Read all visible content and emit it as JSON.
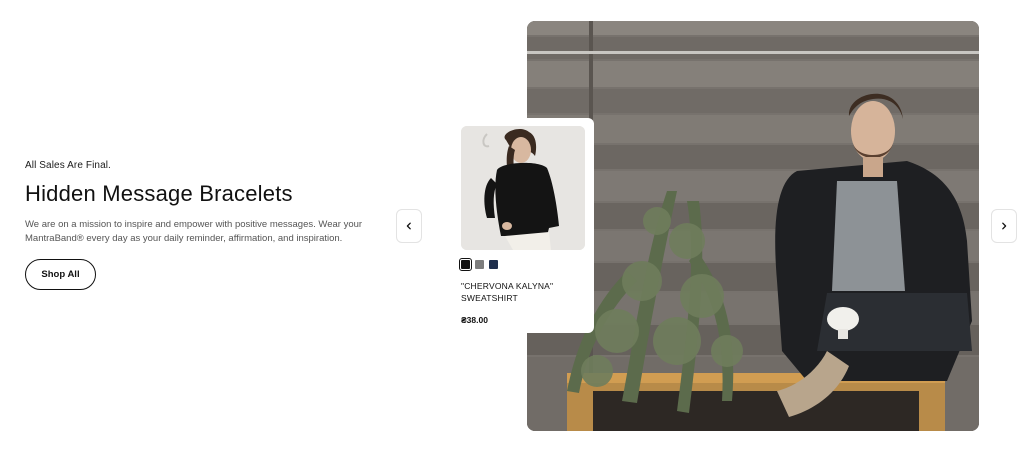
{
  "hero": {
    "eyebrow": "All Sales Are Final.",
    "title": "Hidden Message Bracelets",
    "description": "We are on a mission to inspire and empower with positive messages. Wear your MantraBand® every day as your daily reminder, affirmation, and inspiration.",
    "cta_label": "Shop All"
  },
  "carousel": {
    "prev_icon": "chevron-left-icon",
    "next_icon": "chevron-right-icon"
  },
  "product": {
    "name": "\"CHERVONA KALYNA\" SWEATSHIRT",
    "price": "₴38.00",
    "swatches": [
      {
        "name": "black",
        "color": "#111111",
        "selected": true
      },
      {
        "name": "gray",
        "color": "#7d7d7d",
        "selected": false
      },
      {
        "name": "navy",
        "color": "#1f2f4d",
        "selected": false
      }
    ]
  },
  "colors": {
    "accent": "#111111",
    "text_muted": "#555555",
    "card_bg": "#ffffff"
  }
}
